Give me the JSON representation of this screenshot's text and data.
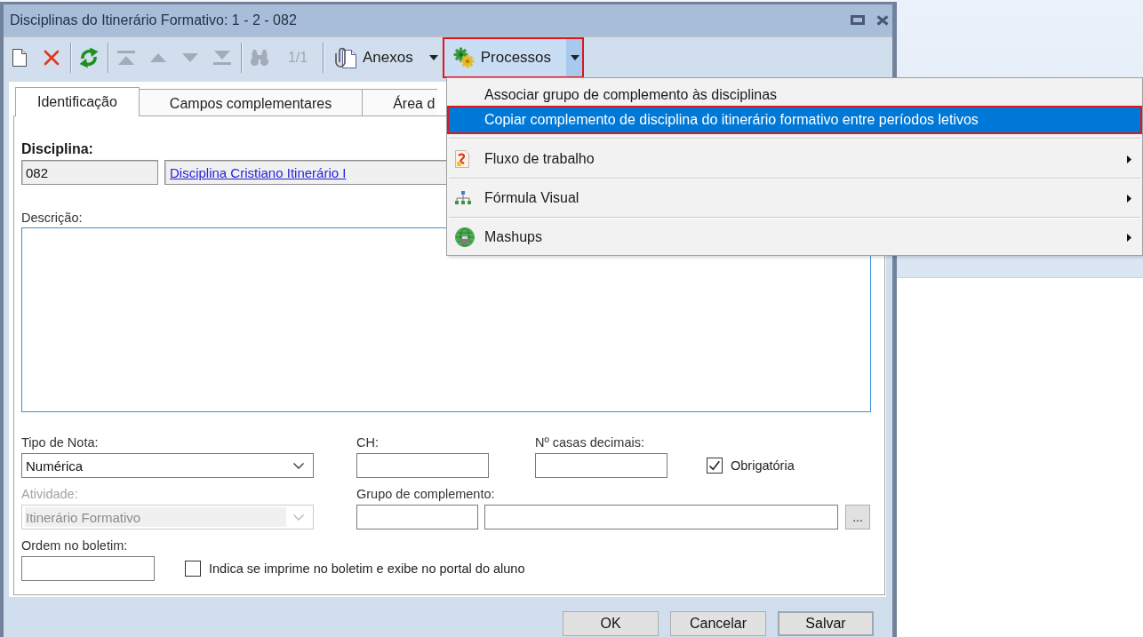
{
  "window": {
    "title": "Disciplinas do Itinerário Formativo: 1 - 2 - 082"
  },
  "toolbar": {
    "items": [
      {
        "kind": "new",
        "disabled": false
      },
      {
        "kind": "delete",
        "disabled": false
      },
      {
        "kind": "separator"
      },
      {
        "kind": "refresh",
        "disabled": false
      },
      {
        "kind": "separator"
      },
      {
        "kind": "first",
        "disabled": true
      },
      {
        "kind": "previous",
        "disabled": true
      },
      {
        "kind": "next",
        "disabled": true
      },
      {
        "kind": "last",
        "disabled": true
      },
      {
        "kind": "separator"
      },
      {
        "kind": "search",
        "disabled": true
      },
      {
        "kind": "counter",
        "text": "1/1",
        "disabled": true
      },
      {
        "kind": "separator"
      },
      {
        "kind": "attachments",
        "label": "Anexos",
        "disabled": false,
        "outlined": false
      },
      {
        "kind": "processes",
        "label": "Processos",
        "disabled": false,
        "open": true,
        "outlined": true
      }
    ]
  },
  "tabs": [
    {
      "label": "Identificação",
      "selected": true
    },
    {
      "label": "Campos complementares",
      "selected": false
    },
    {
      "label": "Área d",
      "selected": false
    }
  ],
  "form": {
    "disciplina": {
      "label": "Disciplina:",
      "code": "082",
      "name": "Disciplina Cristiano Itinerário I"
    },
    "descricao": {
      "label": "Descrição:",
      "focused": true
    },
    "tipo_de_nota": {
      "label": "Tipo de Nota:",
      "value": "Numérica",
      "disabled": false
    },
    "ch": {
      "label": "CH:"
    },
    "casas_decimais": {
      "label": "Nº casas decimais:"
    },
    "obrigatoria": {
      "label": "Obrigatória",
      "checked": true
    },
    "atividade": {
      "label": "Atividade:",
      "value": "Itinerário Formativo",
      "disabled": true
    },
    "grupo_de_complemento": {
      "label": "Grupo de complemento:",
      "button": "..."
    },
    "ordem_no_boletim": {
      "label": "Ordem no boletim:"
    },
    "imprime_no_boletim": {
      "label": "Indica se imprime no boletim e exibe no portal do aluno",
      "checked": false
    }
  },
  "buttons": [
    {
      "label": "OK",
      "default": false
    },
    {
      "label": "Cancelar",
      "default": false
    },
    {
      "label": "Salvar",
      "default": true
    }
  ],
  "menu": {
    "items": [
      {
        "kind": "action",
        "label": "Associar grupo de complemento às disciplinas",
        "selected": false,
        "outlined": false
      },
      {
        "kind": "action",
        "label": "Copiar complemento de disciplina do itinerário formativo entre períodos letivos",
        "selected": true,
        "outlined": true
      },
      {
        "kind": "separator"
      },
      {
        "kind": "submenu",
        "label": "Fluxo de trabalho",
        "selected": false,
        "outlined": false
      },
      {
        "kind": "separator"
      },
      {
        "kind": "submenu",
        "label": "Fórmula Visual",
        "selected": false,
        "outlined": false
      },
      {
        "kind": "separator"
      },
      {
        "kind": "submenu",
        "label": "Mashups",
        "selected": false,
        "outlined": false
      }
    ]
  }
}
